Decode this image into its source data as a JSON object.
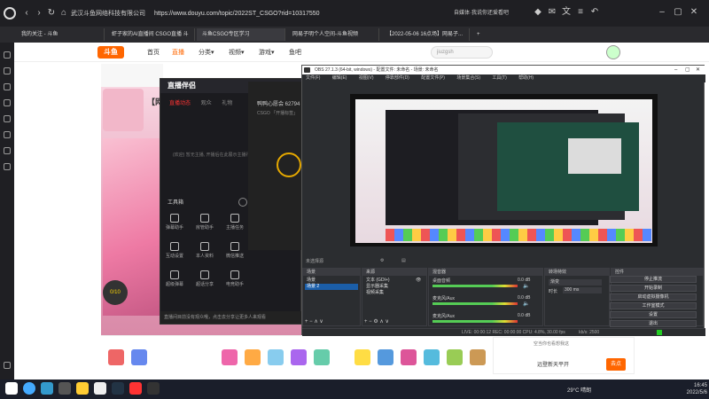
{
  "browser": {
    "site_name": "武汉斗鱼网络科技有限公司",
    "url": "https://www.douyu.com/topic/2022ST_CSGO?rid=10317550",
    "right_info": "自媒体·我说你还爱看吧",
    "tabs": [
      {
        "label": "我的关注 - 斗鱼"
      },
      {
        "label": "虾子家的AI直播间 CSGO直播 斗"
      },
      {
        "label": "斗鱼CSGO专区学习"
      },
      {
        "label": "网易子明个人空间-斗鱼视频"
      },
      {
        "label": "【2022-05-06 16点场】网易子..."
      }
    ]
  },
  "douyu": {
    "logo": "斗鱼",
    "nav": [
      "首页",
      "直播",
      "分类▾",
      "视频▾",
      "游戏▾",
      "鱼吧"
    ],
    "search_placeholder": "jiuzgsh",
    "room_title": "【网易",
    "gift_badge": "0/10",
    "ad_text": "远登新天平开",
    "ad_button": "去点",
    "ad_title": "空当你也看想我这"
  },
  "assistant": {
    "logo": "直播伴侣",
    "tabs": [
      "直播动态",
      "观众",
      "礼物"
    ],
    "empty_text": "(欢迎) 暂无主播, 开播后在此展示主播行",
    "toolbox_title": "工具箱",
    "tools": [
      "弹幕助手",
      "房管助手",
      "主播任务",
      "互动设置",
      "本人资料",
      "微信推送",
      "超级弹幕",
      "超话分享",
      "电竞助手"
    ],
    "room_name": "鸭鸭心愿会 62794",
    "room_sub": "CSGO 「开播标签」",
    "footer": "直播间目前没有观众哦，点击去分享让更多人来观看"
  },
  "obs": {
    "title": "OBS 27.1.3 (64-bit, windows) - 配置文件: 未命名 - 场景: 未命名",
    "menu": [
      "文件(F)",
      "编辑(E)",
      "视图(V)",
      "停靠部件(D)",
      "配置文件(P)",
      "场景集合(S)",
      "工具(T)",
      "帮助(H)"
    ],
    "scene_status": "未选择源",
    "docks": {
      "scenes_title": "场景",
      "scenes": [
        "场景",
        "场景 2"
      ],
      "sources_title": "来源",
      "sources": [
        "文本 (GDI+)",
        "显示器采集",
        "视频采集"
      ],
      "mixer_title": "混音器",
      "mixer": [
        {
          "name": "桌面音频",
          "db": "0.0 dB"
        },
        {
          "name": "麦克风/Aux",
          "db": "0.0 dB"
        },
        {
          "name": "麦克风/Aux",
          "db": "0.0 dB"
        }
      ],
      "transition_title": "转场特效",
      "transition_type": "渐变",
      "duration_label": "时长",
      "duration_value": "300 ms",
      "controls_title": "控件",
      "controls": [
        "停止推流",
        "开始录制",
        "启动虚拟摄像机",
        "工作室模式",
        "设置",
        "退出"
      ]
    },
    "status": "LIVE: 00:00:12   REC: 00:00:00   CPU: 4.8%, 30.00 fps",
    "status_kbps": "kb/s: 2500"
  },
  "taskbar": {
    "weather": "29°C 晴朗",
    "time": "16:45",
    "date": "2022/5/6"
  }
}
